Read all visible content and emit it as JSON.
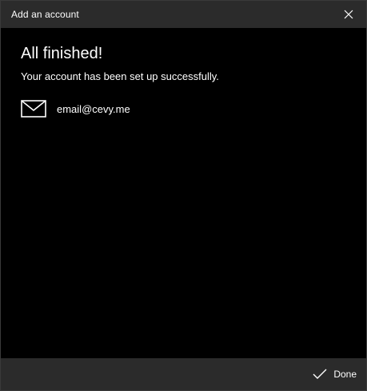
{
  "window": {
    "title": "Add an account"
  },
  "content": {
    "heading": "All finished!",
    "message": "Your account has been set up successfully.",
    "account": {
      "icon": "mail-icon",
      "email": "email@cevy.me"
    }
  },
  "footer": {
    "done_label": "Done",
    "done_icon": "checkmark-icon"
  },
  "colors": {
    "titlebar_bg": "#2b2b2b",
    "content_bg": "#000000",
    "footer_bg": "#2b2b2b",
    "text": "#ffffff"
  }
}
